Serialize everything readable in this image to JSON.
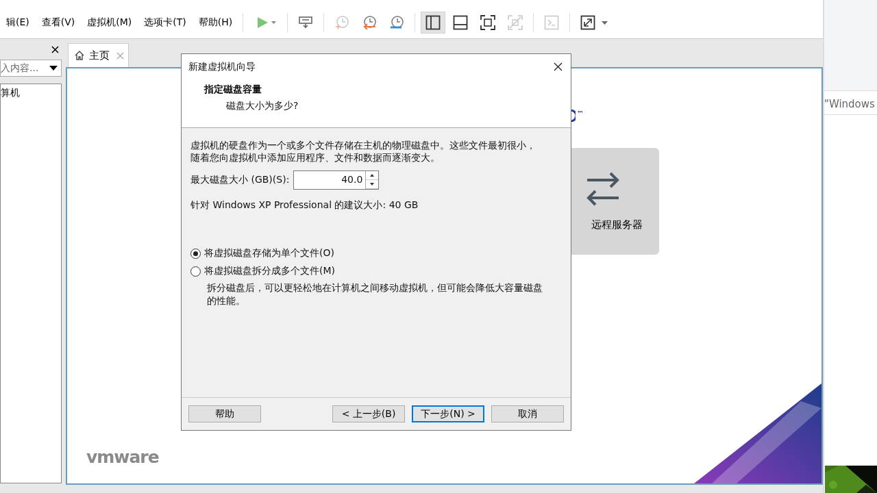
{
  "menu": [
    "辑(E)",
    "查看(V)",
    "虚拟机(M)",
    "选项卡(T)",
    "帮助(H)"
  ],
  "toolbar": [
    {
      "kind": "play",
      "disabled": false,
      "selected": false
    },
    {
      "kind": "send-keys",
      "disabled": false,
      "selected": false
    },
    {
      "kind": "snapshot-take",
      "disabled": true,
      "selected": false
    },
    {
      "kind": "snapshot-revert",
      "disabled": false,
      "selected": false
    },
    {
      "kind": "snapshot-manager",
      "disabled": false,
      "selected": false
    },
    {
      "kind": "view-library",
      "disabled": false,
      "selected": true
    },
    {
      "kind": "view-thumbnail",
      "disabled": false,
      "selected": false
    },
    {
      "kind": "fullscreen",
      "disabled": false,
      "selected": false
    },
    {
      "kind": "unity",
      "disabled": true,
      "selected": false
    },
    {
      "kind": "console",
      "disabled": true,
      "selected": false
    },
    {
      "kind": "stretch",
      "disabled": false,
      "selected": false
    }
  ],
  "library": {
    "search": {
      "placeholder": "入内容..."
    },
    "items": [
      "算机"
    ]
  },
  "tabs": [
    {
      "label": "主页",
      "selected": true
    }
  ],
  "home": {
    "trademark": "™",
    "actions": [
      "远程服务器"
    ],
    "brand": "vmware"
  },
  "side_window": {
    "text": "\"Windows"
  },
  "dialog": {
    "title": "新建虚拟机向导",
    "heading": "指定磁盘容量",
    "subheading": "磁盘大小为多少?",
    "description": "虚拟机的硬盘作为一个或多个文件存储在主机的物理磁盘中。这些文件最初很小，随着您向虚拟机中添加应用程序、文件和数据而逐渐变大。",
    "disk_size": {
      "label": "最大磁盘大小 (GB)(S):",
      "value": "40.0"
    },
    "recommendation": "针对 Windows XP Professional 的建议大小: 40 GB",
    "options": [
      {
        "label": "将虚拟磁盘存储为单个文件(O)",
        "selected": true
      },
      {
        "label": "将虚拟磁盘拆分成多个文件(M)",
        "selected": false,
        "note": "拆分磁盘后，可以更轻松地在计算机之间移动虚拟机，但可能会降低大容量磁盘的性能。"
      }
    ],
    "buttons": [
      {
        "label": "帮助",
        "focused": false
      },
      {
        "label": "< 上一步(B)",
        "focused": false
      },
      {
        "label": "下一步(N) >",
        "focused": true
      },
      {
        "label": "取消",
        "focused": false
      }
    ]
  }
}
